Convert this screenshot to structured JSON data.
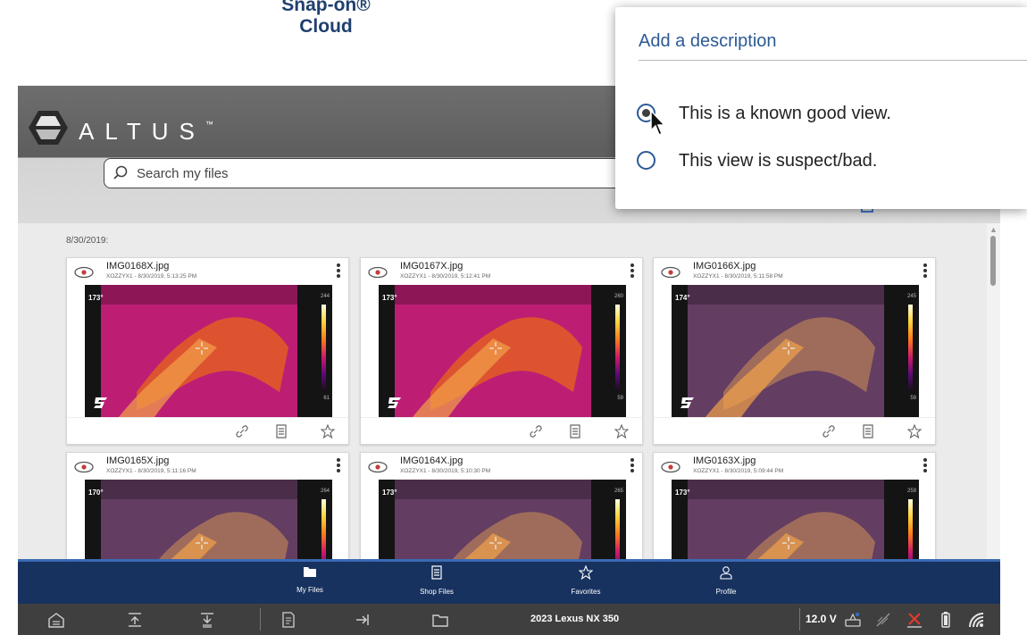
{
  "banner": {
    "line1": "Snap-on®",
    "line2": "Cloud"
  },
  "app": {
    "brand": "ALTUS",
    "brand_tm": "™",
    "search": {
      "placeholder": "Search my files"
    },
    "date_group": "8/30/2019:",
    "colors": {
      "accent": "#17325f",
      "popup_blue": "#2c5a94"
    },
    "cards": [
      {
        "name": "IMG0168X.jpg",
        "meta": "XOZZYX1 - 8/30/2019, 5:13:25 PM",
        "temp": "173°",
        "hi": "244",
        "lo": "61",
        "tone": "hot"
      },
      {
        "name": "IMG0167X.jpg",
        "meta": "XOZZYX1 - 8/30/2019, 5:12:41 PM",
        "temp": "173°",
        "hi": "260",
        "lo": "59",
        "tone": "hot"
      },
      {
        "name": "IMG0166X.jpg",
        "meta": "XOZZYX1 - 8/30/2019, 5:11:58 PM",
        "temp": "174°",
        "hi": "245",
        "lo": "59",
        "tone": "blend"
      },
      {
        "name": "IMG0165X.jpg",
        "meta": "XOZZYX1 - 8/30/2019, 5:11:16 PM",
        "temp": "170°",
        "hi": "264",
        "lo": "",
        "tone": "blend"
      },
      {
        "name": "IMG0164X.jpg",
        "meta": "XOZZYX1 - 8/30/2019, 5:10:30 PM",
        "temp": "173°",
        "hi": "265",
        "lo": "",
        "tone": "blend"
      },
      {
        "name": "IMG0163X.jpg",
        "meta": "XOZZYX1 - 8/30/2019, 5:09:44 PM",
        "temp": "173°",
        "hi": "259",
        "lo": "",
        "tone": "blend"
      }
    ],
    "card_actions": [
      "link-icon",
      "notes-icon",
      "star-icon"
    ],
    "card_menu_icon": "kebab-icon"
  },
  "bottom_nav": {
    "items": [
      {
        "label": "My Files",
        "icon": "folder-icon"
      },
      {
        "label": "Shop Files",
        "icon": "shop-files-icon"
      },
      {
        "label": "Favorites",
        "icon": "star-icon"
      },
      {
        "label": "Profile",
        "icon": "profile-icon"
      }
    ]
  },
  "system_bar": {
    "vehicle": "2023 Lexus NX 350",
    "voltage": "12.0 V",
    "left_icons": [
      "home-icon",
      "scroll-top-icon",
      "scroll-bottom-icon",
      "document-icon",
      "export-icon",
      "folder-icon"
    ],
    "right_icons": [
      "vehicle-link-icon",
      "no-signal-icon",
      "warning-icon",
      "battery-icon",
      "wifi-icon"
    ]
  },
  "popup": {
    "title": "Add a description",
    "options": [
      {
        "label": "This is a known good view.",
        "selected": true
      },
      {
        "label": "This view is suspect/bad.",
        "selected": false
      }
    ]
  }
}
